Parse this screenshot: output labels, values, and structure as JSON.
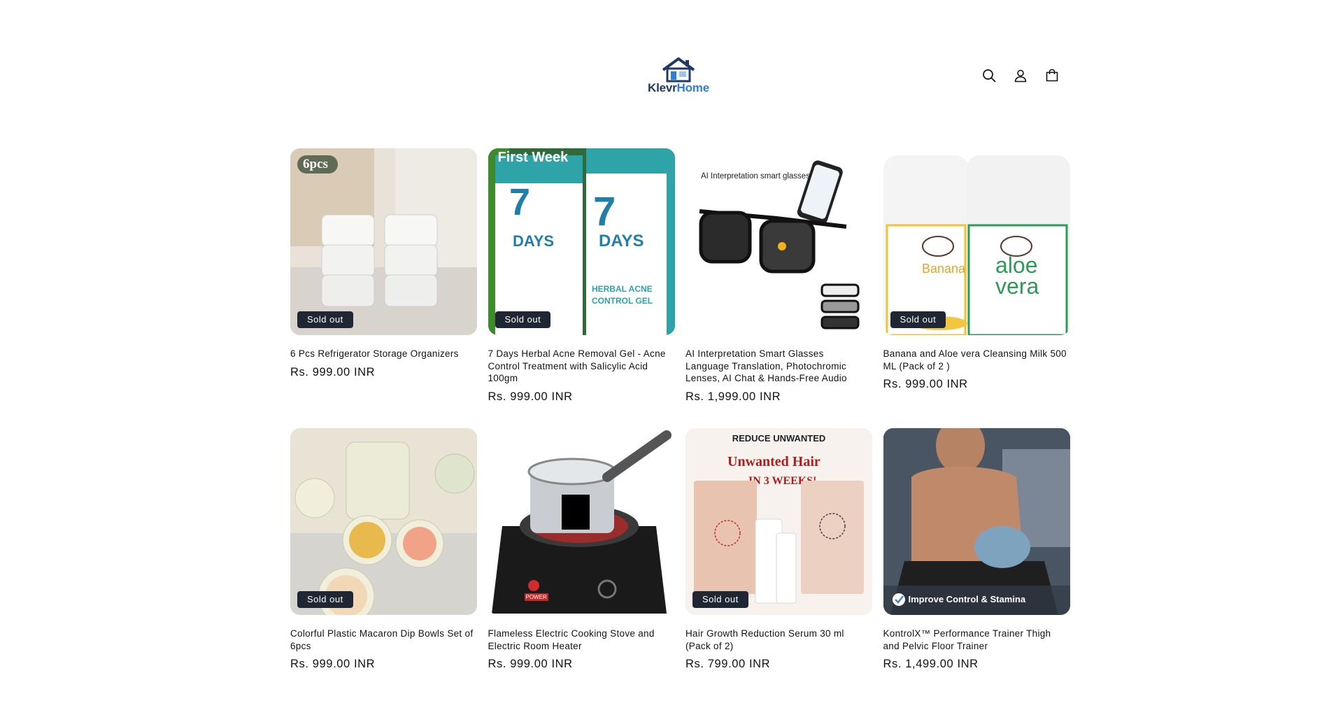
{
  "header": {
    "logo_part1": "Klevr",
    "logo_part2": "Home",
    "icons": [
      "search-icon",
      "account-icon",
      "cart-icon"
    ]
  },
  "colors": {
    "badge_bg": "#1e2733",
    "logo_dark": "#1f3a63",
    "logo_blue": "#2f7fd3",
    "text": "#121212"
  },
  "products": [
    {
      "title": "6 Pcs Refrigerator Storage Organizers",
      "price": "Rs. 999.00 INR",
      "badge": "Sold out",
      "image_text": "6pcs"
    },
    {
      "title": "7 Days Herbal Acne Removal Gel - Acne Control Treatment with Salicylic Acid 100gm",
      "price": "Rs. 999.00 INR",
      "badge": "Sold out",
      "image_text": "First Week"
    },
    {
      "title": "AI Interpretation Smart Glasses Language Translation, Photochromic Lenses, AI Chat & Hands-Free Audio",
      "price": "Rs. 1,999.00 INR",
      "badge": "",
      "image_text": "AI Interpretation smart glasses"
    },
    {
      "title": "Banana and Aloe vera Cleansing Milk 500 ML (Pack of 2 )",
      "price": "Rs. 999.00 INR",
      "badge": "Sold out",
      "image_text": "Banana / aloe vera"
    },
    {
      "title": "Colorful Plastic Macaron Dip Bowls Set of 6pcs",
      "price": "Rs. 999.00 INR",
      "badge": "Sold out",
      "image_text": ""
    },
    {
      "title": "Flameless Electric Cooking Stove and Electric Room Heater",
      "price": "Rs. 999.00 INR",
      "badge": "",
      "image_text": "POWER"
    },
    {
      "title": "Hair Growth Reduction Serum 30 ml (Pack of 2)",
      "price": "Rs. 799.00 INR",
      "badge": "Sold out",
      "image_text": "REDUCE UNWANTED"
    },
    {
      "title": "KontrolX™ Performance Trainer Thigh and Pelvic Floor Trainer",
      "price": "Rs. 1,499.00 INR",
      "badge": "",
      "image_text": "Improve Control & Stamina"
    }
  ]
}
